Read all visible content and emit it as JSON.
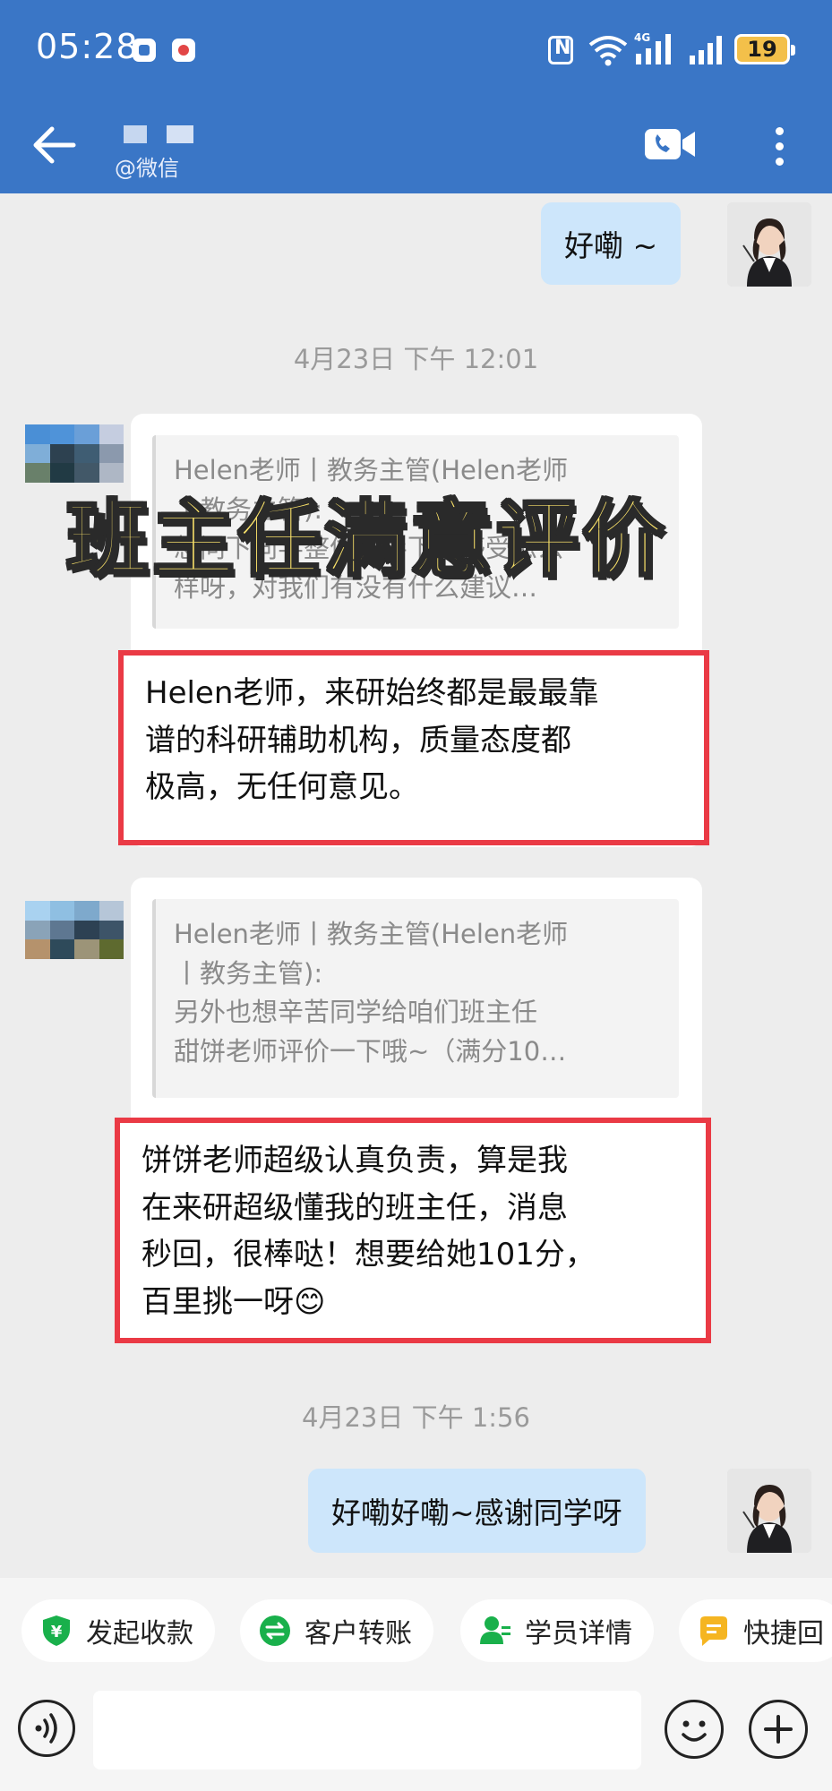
{
  "status_bar": {
    "time": "05:28",
    "battery": "19",
    "network": "4G"
  },
  "header": {
    "contact_sub": "@微信"
  },
  "messages": {
    "top_reply": "好嘞 ~",
    "timestamp_1": "4月23日  下午 12:01",
    "timestamp_2": "4月23日  下午 1:56",
    "bottom_reply": "好嘞好嘞~感谢同学呀"
  },
  "overlay": {
    "title": "班主任满意评价"
  },
  "card1": {
    "quote_lines": [
      "Helen老师丨教务主管(Helen老师",
      "丨教务主管):",
      "想问下同学整体辅导下来感受怎么",
      "样呀，对我们有没有什么建议…"
    ],
    "reply_lines": [
      "Helen老师，来研始终都是最最靠",
      "谱的科研辅助机构，质量态度都",
      "极高，无任何意见。"
    ]
  },
  "card2": {
    "quote_lines": [
      "Helen老师丨教务主管(Helen老师",
      "丨教务主管):",
      "另外也想辛苦同学给咱们班主任",
      "甜饼老师评价一下哦~（满分10…"
    ],
    "reply_lines": [
      "饼饼老师超级认真负责，算是我",
      "在来研超级懂我的班主任，消息",
      "秒回，很棒哒！想要给她101分，",
      "百里挑一呀"
    ],
    "reply_emoji": "😊"
  },
  "toolbar": {
    "chips": [
      "发起收款",
      "客户转账",
      "学员详情",
      "快捷回"
    ]
  },
  "colors": {
    "brand_blue": "#3a76c6",
    "my_bubble": "#cde6fb",
    "highlight_red": "#ea3a45",
    "title_yellow": "#fbe36a",
    "chip_green": "#19b04b",
    "chip_yellow": "#f5b521"
  },
  "icons": {
    "back": "arrow-left-icon",
    "video": "video-call-icon",
    "more": "more-vertical-icon",
    "voice": "voice-icon",
    "emoji": "emoji-icon",
    "plus": "plus-icon"
  }
}
